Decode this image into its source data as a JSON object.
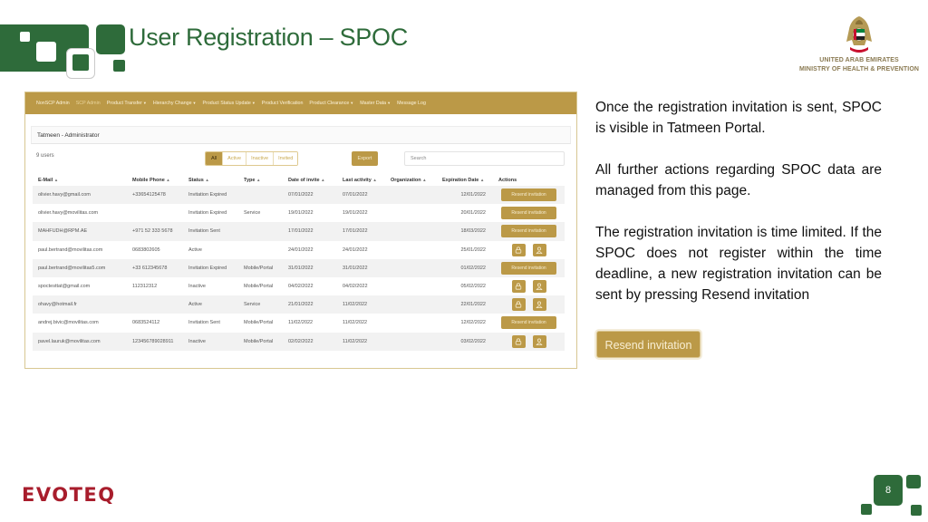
{
  "slide": {
    "title": "User Registration – SPOC",
    "page_number": "8",
    "brand_color": "#2e6b3a",
    "accent_color": "#bb9947"
  },
  "ministry": {
    "line1": "UNITED ARAB EMIRATES",
    "line2": "MINISTRY OF HEALTH & PREVENTION"
  },
  "portal": {
    "nav": [
      {
        "label": "NonSCP Admin",
        "caret": false,
        "active": false
      },
      {
        "label": "SCP Admin",
        "caret": false,
        "active": true
      },
      {
        "label": "Product Transfer",
        "caret": true,
        "active": false
      },
      {
        "label": "Hierarchy Change",
        "caret": true,
        "active": false
      },
      {
        "label": "Product Status Update",
        "caret": true,
        "active": false
      },
      {
        "label": "Product Verification",
        "caret": false,
        "active": false
      },
      {
        "label": "Product Clearance",
        "caret": true,
        "active": false
      },
      {
        "label": "Master Data",
        "caret": true,
        "active": false
      },
      {
        "label": "Message Log",
        "caret": false,
        "active": false
      }
    ],
    "section_title": "Tatmeen - Administrator",
    "users_count": "9 users",
    "filters": [
      "All",
      "Active",
      "Inactive",
      "Invited"
    ],
    "export_label": "Export",
    "search_placeholder": "Search",
    "columns": [
      "E-Mail",
      "Mobile Phone",
      "Status",
      "Type",
      "Date of invite",
      "Last activity",
      "Organization",
      "Expiration Date",
      "Actions"
    ],
    "rows": [
      {
        "email": "olivier.havy@gmail.com",
        "phone": "+33654125478",
        "status": "Invitation Expired",
        "type": "",
        "invite": "07/01/2022",
        "last": "07/01/2022",
        "org": "",
        "expiry": "12/01/2022",
        "action": "resend"
      },
      {
        "email": "olivier.havy@movilitas.com",
        "phone": "",
        "status": "Invitation Expired",
        "type": "Service",
        "invite": "19/01/2022",
        "last": "19/01/2022",
        "org": "",
        "expiry": "20/01/2022",
        "action": "resend"
      },
      {
        "email": "MAHFUDH@RPM.AE",
        "phone": "+971 52 333 5678",
        "status": "Invitation Sent",
        "type": "",
        "invite": "17/01/2022",
        "last": "17/01/2022",
        "org": "",
        "expiry": "18/03/2022",
        "action": "resend"
      },
      {
        "email": "paul.bertrand@movilitas.com",
        "phone": "0683802605",
        "status": "Active",
        "type": "",
        "invite": "24/01/2022",
        "last": "24/01/2022",
        "org": "",
        "expiry": "25/01/2022",
        "action": "icons"
      },
      {
        "email": "paul.bertrand@movilitas5.com",
        "phone": "+33 612345678",
        "status": "Invitation Expired",
        "type": "Mobile/Portal",
        "invite": "31/01/2022",
        "last": "31/01/2022",
        "org": "",
        "expiry": "01/02/2022",
        "action": "resend"
      },
      {
        "email": "spoctesttat@gmail.com",
        "phone": "112312312",
        "status": "Inactive",
        "type": "Mobile/Portal",
        "invite": "04/02/2022",
        "last": "04/02/2022",
        "org": "",
        "expiry": "05/02/2022",
        "action": "icons"
      },
      {
        "email": "ohavy@hotmail.fr",
        "phone": "",
        "status": "Active",
        "type": "Service",
        "invite": "21/01/2022",
        "last": "11/02/2022",
        "org": "",
        "expiry": "22/01/2022",
        "action": "icons"
      },
      {
        "email": "andrej.bivic@movilitas.com",
        "phone": "0683524112",
        "status": "Invitation Sent",
        "type": "Mobile/Portal",
        "invite": "11/02/2022",
        "last": "11/02/2022",
        "org": "",
        "expiry": "12/02/2022",
        "action": "resend"
      },
      {
        "email": "pavel.lauruk@movilitas.com",
        "phone": "123456789028911",
        "status": "Inactive",
        "type": "Mobile/Portal",
        "invite": "02/02/2022",
        "last": "11/02/2022",
        "org": "",
        "expiry": "03/02/2022",
        "action": "icons"
      }
    ],
    "resend_label": "Resend invitation",
    "action_icons": [
      "lock-icon",
      "user-icon"
    ]
  },
  "explanation": {
    "p1": "Once the registration invitation is sent, SPOC is visible in Tatmeen Portal.",
    "p2": "All further actions regarding SPOC data are managed from this page.",
    "p3": "The registration invitation is time limited. If the SPOC does not register within the time deadline, a new registration invitation can be sent by pressing Resend invitation",
    "button_label": "Resend invitation"
  },
  "footer": {
    "brand": "EVOTEQ"
  }
}
